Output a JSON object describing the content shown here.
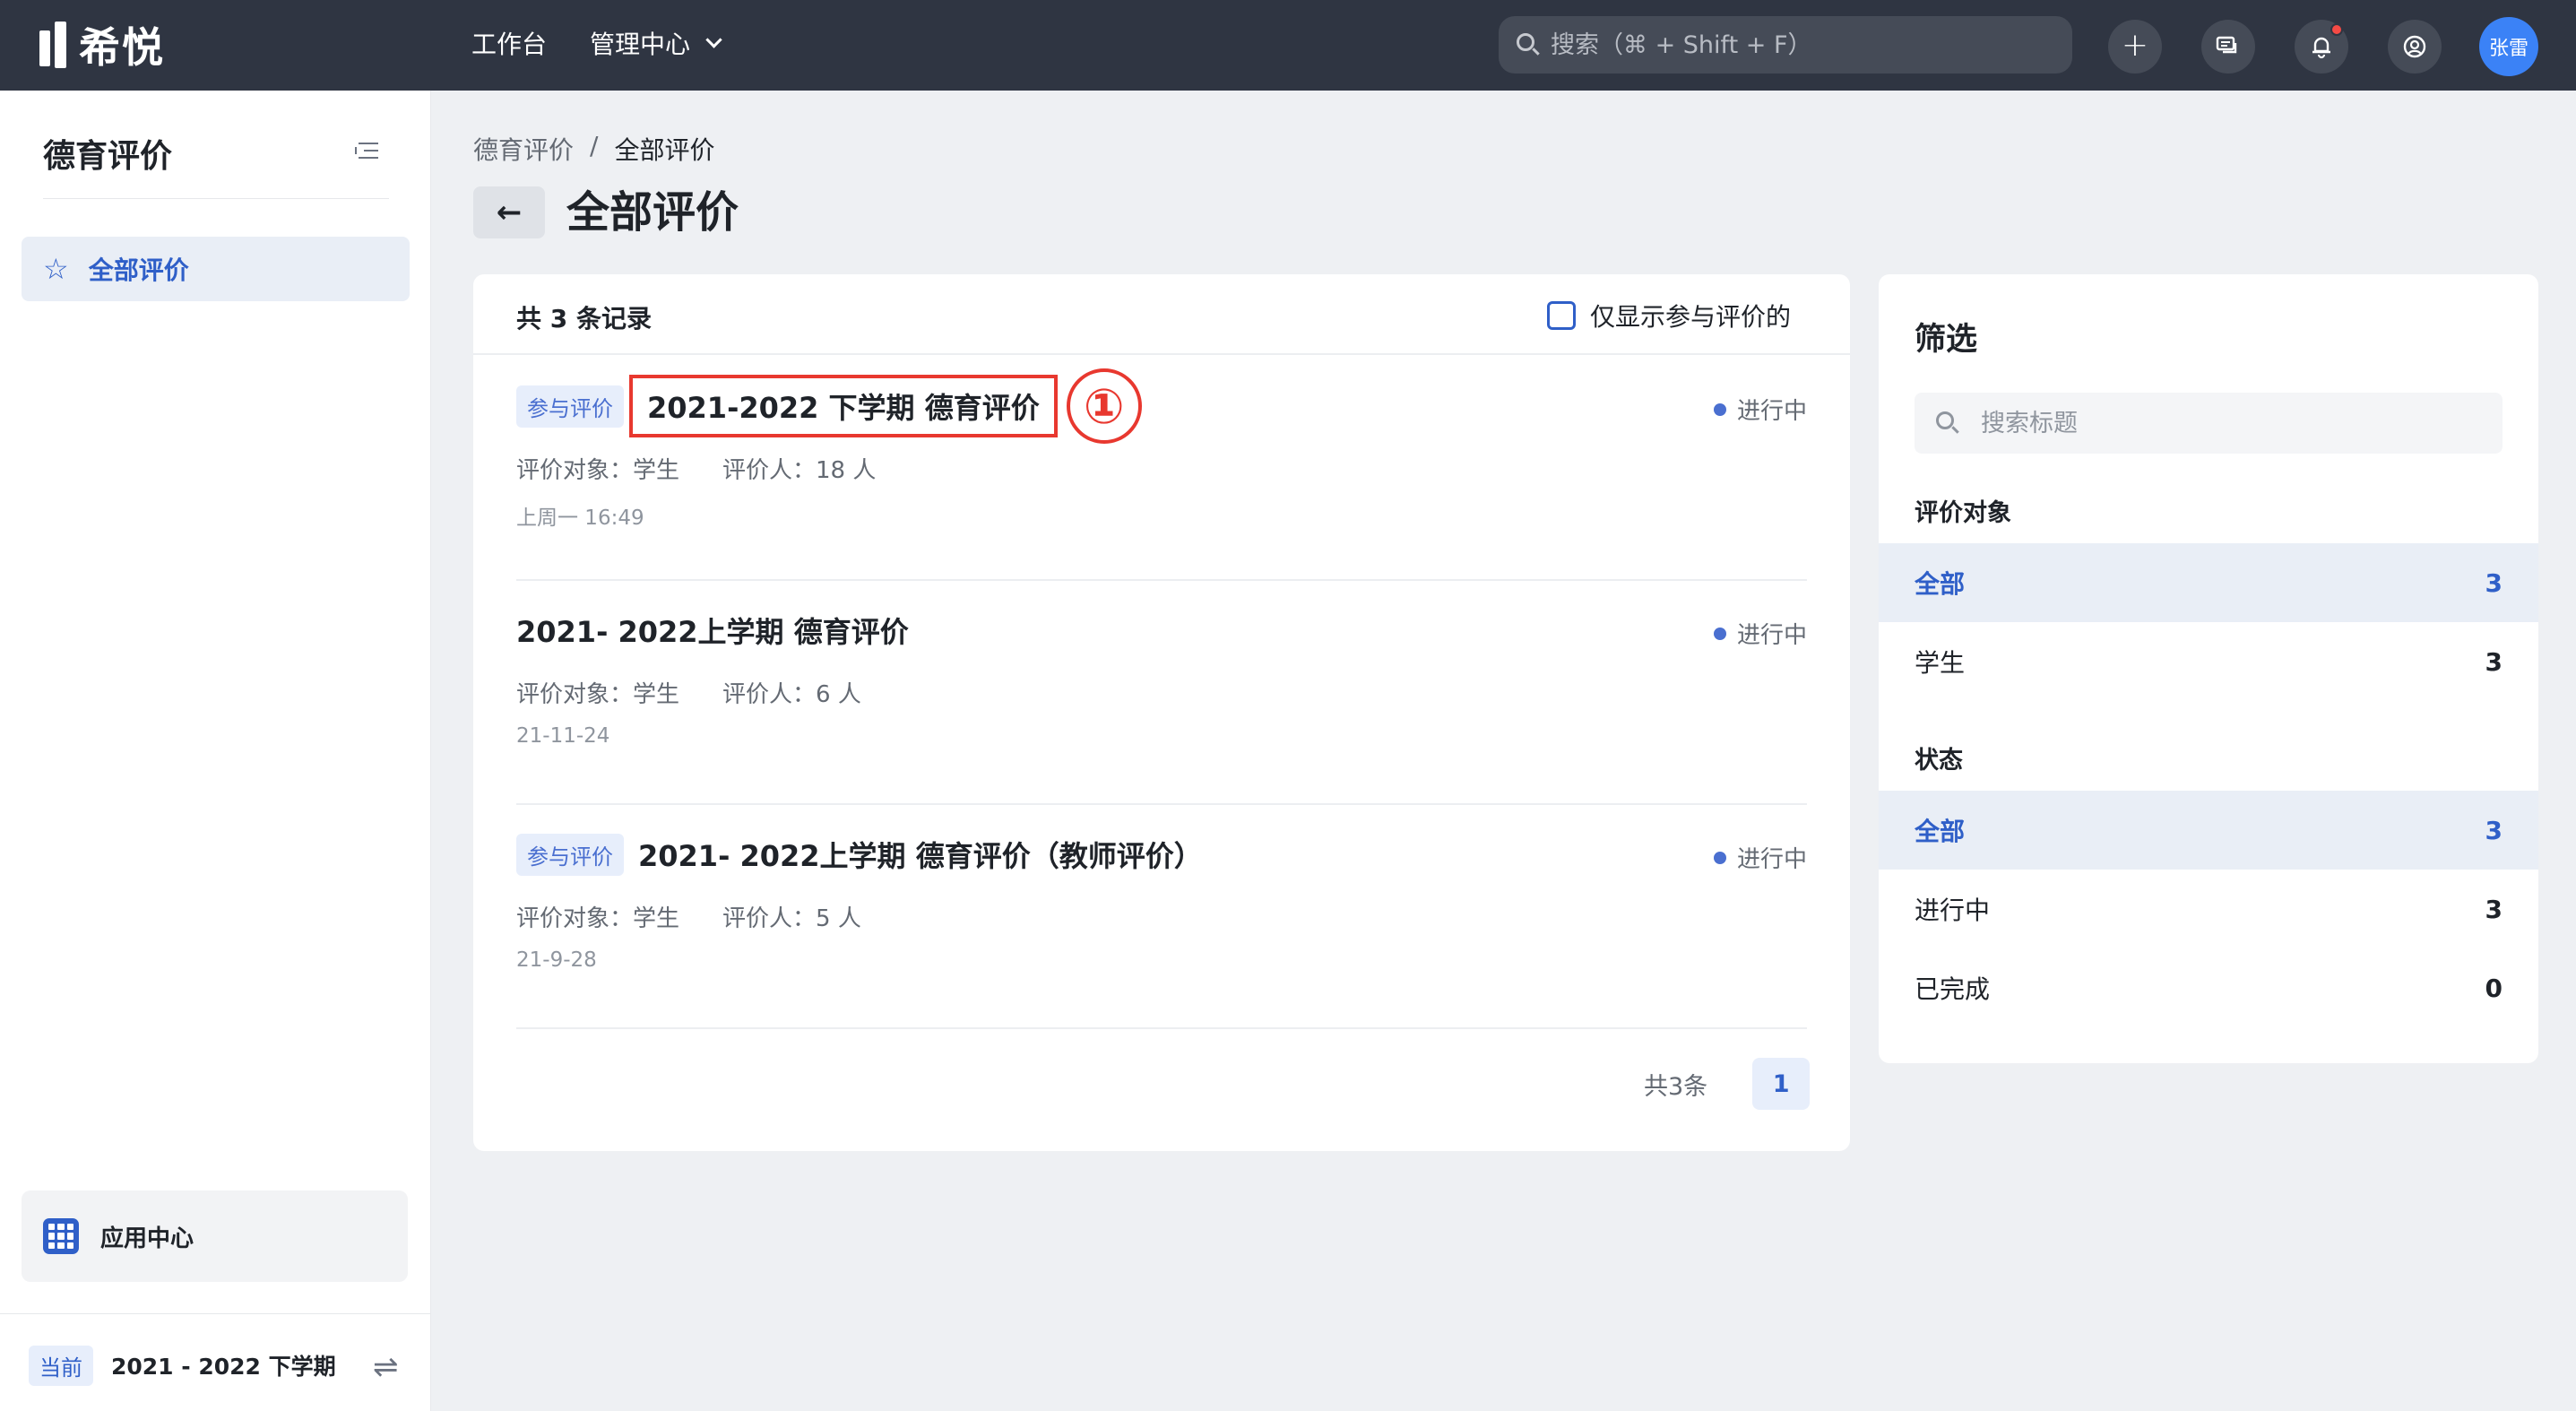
{
  "app": {
    "name": "希悦"
  },
  "topbar": {
    "nav_workbench": "工作台",
    "nav_admin": "管理中心",
    "search_placeholder": "搜索（⌘ + Shift + F）",
    "avatar_text": "张雷"
  },
  "sidebar": {
    "title": "德育评价",
    "items": [
      {
        "label": "全部评价",
        "icon": "star-icon",
        "active": true
      }
    ],
    "app_center": "应用中心",
    "term_badge": "当前",
    "term": "2021 - 2022 下学期"
  },
  "breadcrumb": {
    "parent": "德育评价",
    "separator": "/",
    "current": "全部评价"
  },
  "page_title": "全部评价",
  "list": {
    "total": "共 3 条记录",
    "only_mine": "仅显示参与评价的",
    "items": [
      {
        "tag": "参与评价",
        "title": "2021-2022 下学期 德育评价",
        "status": "进行中",
        "target": "评价对象：学生",
        "raters": "评价人：18 人",
        "date": "上周一 16:49",
        "highlight_marker": "①"
      },
      {
        "tag": "",
        "title": "2021- 2022上学期 德育评价",
        "status": "进行中",
        "target": "评价对象：学生",
        "raters": "评价人：6 人",
        "date": "21-11-24"
      },
      {
        "tag": "参与评价",
        "title": "2021- 2022上学期 德育评价（教师评价）",
        "status": "进行中",
        "target": "评价对象：学生",
        "raters": "评价人：5 人",
        "date": "21-9-28"
      }
    ],
    "pager_total": "共3条",
    "current_page": "1"
  },
  "filter": {
    "title": "筛选",
    "search_placeholder": "搜索标题",
    "target_section": "评价对象",
    "targets": [
      {
        "label": "全部",
        "count": "3",
        "active": true
      },
      {
        "label": "学生",
        "count": "3",
        "active": false
      }
    ],
    "status_section": "状态",
    "statuses": [
      {
        "label": "全部",
        "count": "3",
        "active": true
      },
      {
        "label": "进行中",
        "count": "3",
        "active": false
      },
      {
        "label": "已完成",
        "count": "0",
        "active": false
      }
    ]
  },
  "colors": {
    "topbar": "#2f3542",
    "accent": "#2f5fc8",
    "highlight": "#e8382f",
    "status_dot": "#4a6fd0"
  }
}
